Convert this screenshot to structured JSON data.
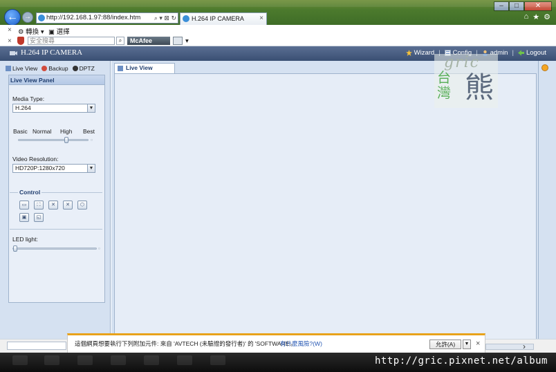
{
  "browser": {
    "address": "http://192.168.1.97:88/index.htm",
    "tab_title": "H.264 IP CAMERA",
    "tab_close": "×",
    "window_controls": [
      "–",
      "□",
      "✕"
    ],
    "toolbar1": {
      "close": "×",
      "convert_label": "轉換",
      "select_label": "選擇"
    },
    "toolbar2": {
      "close": "×",
      "search_placeholder": "安全搜尋",
      "mcafee_label": "McAfee"
    }
  },
  "app": {
    "title": "H.264 IP CAMERA",
    "links": {
      "wizard": "Wizard",
      "config": "Config",
      "admin": "admin",
      "logout": "Logout"
    }
  },
  "sidebar": {
    "tabs": [
      "Live View",
      "Backup",
      "DPTZ"
    ],
    "panel_title": "Live View Panel",
    "media_type_label": "Media Type:",
    "media_type_value": "H.264",
    "quality_labels": [
      "Basic",
      "Normal",
      "High",
      "Best"
    ],
    "quality_level": "High",
    "resolution_label": "Video Resolution:",
    "resolution_value": "HD720P:1280x720",
    "control_legend": "Control",
    "led_label": "LED light:"
  },
  "main": {
    "tab_label": "Live View"
  },
  "infobar": {
    "message": "這個網頁想要執行下列附加元件: 來自 'AVTECH (未驗證的發行者)' 的 'SOFTWARE'。",
    "risk_link": "有什麼風險?(W)",
    "allow_button": "允許(A)",
    "close": "×"
  },
  "watermark": {
    "latin": "gric",
    "cjk_small": "台灣",
    "cjk_large": "熊"
  },
  "footer_url": "http://gric.pixnet.net/album"
}
